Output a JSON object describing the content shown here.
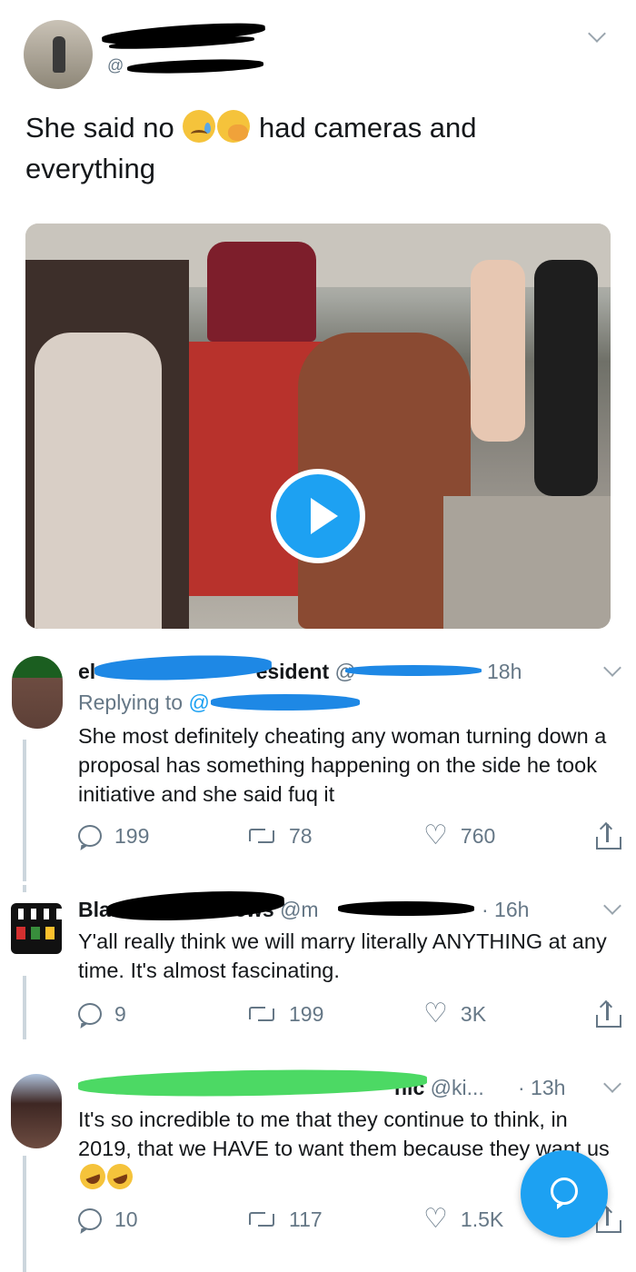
{
  "main_tweet": {
    "handle": "@",
    "text_before": "She said no",
    "text_after": "had cameras and everything",
    "emojis": [
      "crying-face-emoji",
      "face-with-hand-over-mouth-emoji"
    ]
  },
  "replies": [
    {
      "name_visible": "el",
      "name_suffix": "esident",
      "handle": "@",
      "time": "18h",
      "replying_label": "Replying to",
      "replying_handle": "@",
      "text": "She most definitely cheating any woman turning down a proposal has something happening on the side he took initiative and she said fuq it",
      "reply_count": "199",
      "retweet_count": "78",
      "like_count": "760"
    },
    {
      "name_visible": "Bla",
      "name_suffix": "ews",
      "handle": "@m",
      "time": "· 16h",
      "text": "Y'all really think we will marry literally ANYTHING at any time. It's almost fascinating.",
      "reply_count": "9",
      "retweet_count": "199",
      "like_count": "3K"
    },
    {
      "name_visible": "",
      "name_suffix": "hic",
      "handle": "@ki...",
      "time": "· 13h",
      "text": "It's so incredible to me that they continue to think, in 2019, that we HAVE to want them because they want us",
      "reply_count": "10",
      "retweet_count": "117",
      "like_count": "1.5K"
    }
  ],
  "colors": {
    "accent": "#1da1f2",
    "secondary_text": "#657786",
    "primary_text": "#14171a",
    "redaction_black": "#000000",
    "redaction_blue": "#1e88e5",
    "redaction_green": "#4cd964"
  }
}
